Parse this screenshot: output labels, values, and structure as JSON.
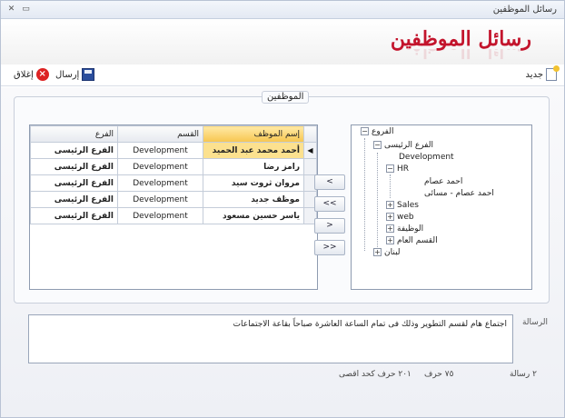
{
  "window": {
    "title": "رسائل الموظفين"
  },
  "header": {
    "title": "رسائل الموظفين"
  },
  "toolbar": {
    "new_label": "جديد",
    "send_label": "إرسال",
    "close_label": "إغلاق"
  },
  "group": {
    "title": "الموظفين"
  },
  "grid": {
    "columns": [
      "إسم الموظف",
      "القسم",
      "الفرع"
    ],
    "rows": [
      {
        "name": "أحمد محمد عبد الحميد",
        "dept": "Development",
        "branch": "الفرع الرئيسى"
      },
      {
        "name": "رامز رضا",
        "dept": "Development",
        "branch": "الفرع الرئيسى"
      },
      {
        "name": "مروان ثروت سيد",
        "dept": "Development",
        "branch": "الفرع الرئيسى"
      },
      {
        "name": "موظف جديد",
        "dept": "Development",
        "branch": "الفرع الرئيسى"
      },
      {
        "name": "ياسر حسين مسعود",
        "dept": "Development",
        "branch": "الفرع الرئيسى"
      }
    ]
  },
  "transfer": {
    "one_left": "<",
    "all_left": "<<",
    "one_right": ">",
    "all_right": ">>"
  },
  "tree": {
    "root": "الفروع",
    "main_branch": "الفرع الرئيسى",
    "development": "Development",
    "hr": "HR",
    "hr_emp1": "احمد عصام",
    "hr_emp2": "احمد عصام - مسائى",
    "sales": "Sales",
    "web": "web",
    "jobs": "الوظيفة",
    "general": "القسم العام",
    "lebanon": "لبنان"
  },
  "message": {
    "label": "الرسالة",
    "text": "اجتماع هام لقسم التطوير وذلك فى تمام الساعة العاشرة صباحاً بقاعة الاجتماعات"
  },
  "status": {
    "messages": "٢ رسالة",
    "chars": "٧٥ حرف",
    "max": "٢٠١ حرف كحد اقصى"
  }
}
